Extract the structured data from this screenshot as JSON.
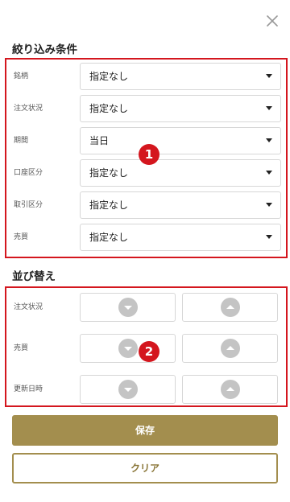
{
  "filter": {
    "title": "絞り込み条件",
    "rows": [
      {
        "label": "銘柄",
        "value": "指定なし"
      },
      {
        "label": "注文状況",
        "value": "指定なし"
      },
      {
        "label": "期間",
        "value": "当日"
      },
      {
        "label": "口座区分",
        "value": "指定なし"
      },
      {
        "label": "取引区分",
        "value": "指定なし"
      },
      {
        "label": "売買",
        "value": "指定なし"
      }
    ]
  },
  "sort": {
    "title": "並び替え",
    "rows": [
      {
        "label": "注文状況"
      },
      {
        "label": "売買"
      },
      {
        "label": "更新日時"
      }
    ]
  },
  "annotations": {
    "badge1": "1",
    "badge2": "2"
  },
  "buttons": {
    "save": "保存",
    "clear": "クリア"
  },
  "colors": {
    "accent": "#a38e4e",
    "highlight": "#d4161e"
  },
  "icons": {
    "close": "close-icon",
    "sort_desc": "sort-descending-icon",
    "sort_asc": "sort-ascending-icon"
  }
}
